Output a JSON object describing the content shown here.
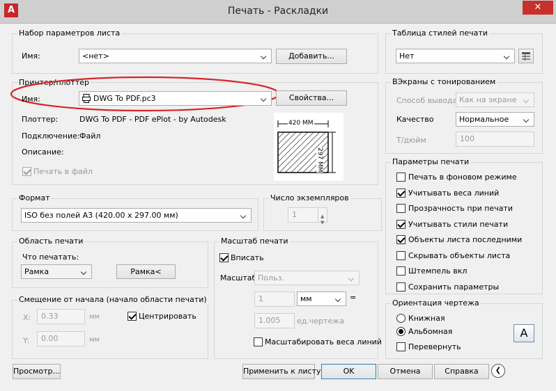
{
  "window": {
    "title": "Печать - Раскладки",
    "app_icon": "A",
    "close_label": "✕"
  },
  "page_setup": {
    "title": "Набор параметров листа",
    "name_label": "Имя:",
    "name_value": "<нет>",
    "add_button": "Добавить..."
  },
  "printer": {
    "title": "Принтер/плоттер",
    "name_label": "Имя:",
    "name_value": "DWG To PDF.pc3",
    "properties_button": "Свойства...",
    "plotter_label": "Плоттер:",
    "plotter_value": "DWG To PDF - PDF ePlot - by Autodesk",
    "connection_label": "Подключение:",
    "connection_value": "Файл",
    "description_label": "Описание:",
    "print_to_file_label": "Печать в файл",
    "paper_width": "420  MM",
    "paper_height": "297 MM"
  },
  "format": {
    "title": "Формат",
    "value": "ISO без полей A3 (420.00 x 297.00 мм)"
  },
  "copies": {
    "title": "Число экземпляров",
    "value": "1"
  },
  "print_area": {
    "title": "Область печати",
    "what_label": "Что печатать:",
    "what_value": "Рамка",
    "frame_button": "Рамка<"
  },
  "offset": {
    "title": "Смещение от начала (начало области печати)",
    "x_label": "X:",
    "x_value": "0.33",
    "x_unit": "мм",
    "y_label": "Y:",
    "y_value": "0.00",
    "y_unit": "мм",
    "center_label": "Центрировать"
  },
  "scale": {
    "title": "Масштаб печати",
    "fit_label": "Вписать",
    "scale_label": "Масштаб:",
    "scale_value": "Польз.",
    "value1": "1",
    "unit_value": "мм",
    "equals": "=",
    "value2": "1.005",
    "unit2_label": "ед.чертежа",
    "lineweights_label": "Масштабировать веса линий"
  },
  "plot_style": {
    "title": "Таблица стилей печати",
    "value": "Нет"
  },
  "shaded": {
    "title": "ВЭкраны с тонированием",
    "output_label": "Способ вывода",
    "output_value": "Как на экране",
    "quality_label": "Качество",
    "quality_value": "Нормальное",
    "dpi_label": "Т/дюйм",
    "dpi_value": "100"
  },
  "options": {
    "title": "Параметры печати",
    "items": [
      {
        "label": "Печать в фоновом режиме",
        "checked": false
      },
      {
        "label": "Учитывать веса линий",
        "checked": true
      },
      {
        "label": "Прозрачность при печати",
        "checked": false
      },
      {
        "label": "Учитывать стили печати",
        "checked": true
      },
      {
        "label": "Объекты листа последними",
        "checked": true
      },
      {
        "label": "Скрывать объекты листа",
        "checked": false
      },
      {
        "label": "Штемпель вкл",
        "checked": false
      },
      {
        "label": "Сохранить параметры",
        "checked": false
      }
    ]
  },
  "orientation": {
    "title": "Ориентация чертежа",
    "portrait_label": "Книжная",
    "landscape_label": "Альбомная",
    "flip_label": "Перевернуть",
    "icon_letter": "A"
  },
  "footer": {
    "preview_button": "Просмотр...",
    "apply_button": "Применить к листу",
    "ok_button": "OK",
    "cancel_button": "Отмена",
    "help_button": "Справка",
    "collapse_icon": "❮"
  },
  "colors": {
    "annotation_red": "#d8232a",
    "dialog_bg": "#f0f0f0",
    "default_button_border": "#3c7fb1"
  }
}
